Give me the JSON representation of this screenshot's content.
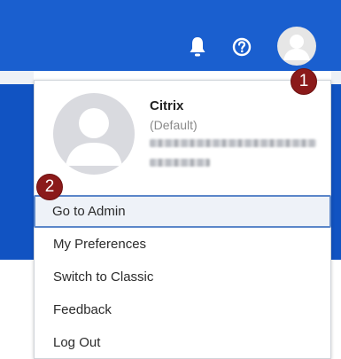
{
  "header": {
    "icons": [
      "bell-icon",
      "help-icon",
      "user-avatar-icon"
    ],
    "accent_color": "#1a5fcf"
  },
  "badges": {
    "first": "1",
    "second": "2",
    "color": "#8b1a1a"
  },
  "profile": {
    "name": "Citrix",
    "tag": "(Default)"
  },
  "menu": {
    "items": [
      {
        "label": "Go to Admin",
        "highlighted": true
      },
      {
        "label": "My Preferences"
      },
      {
        "label": "Switch to Classic"
      },
      {
        "label": "Feedback"
      },
      {
        "label": "Log Out"
      }
    ]
  }
}
